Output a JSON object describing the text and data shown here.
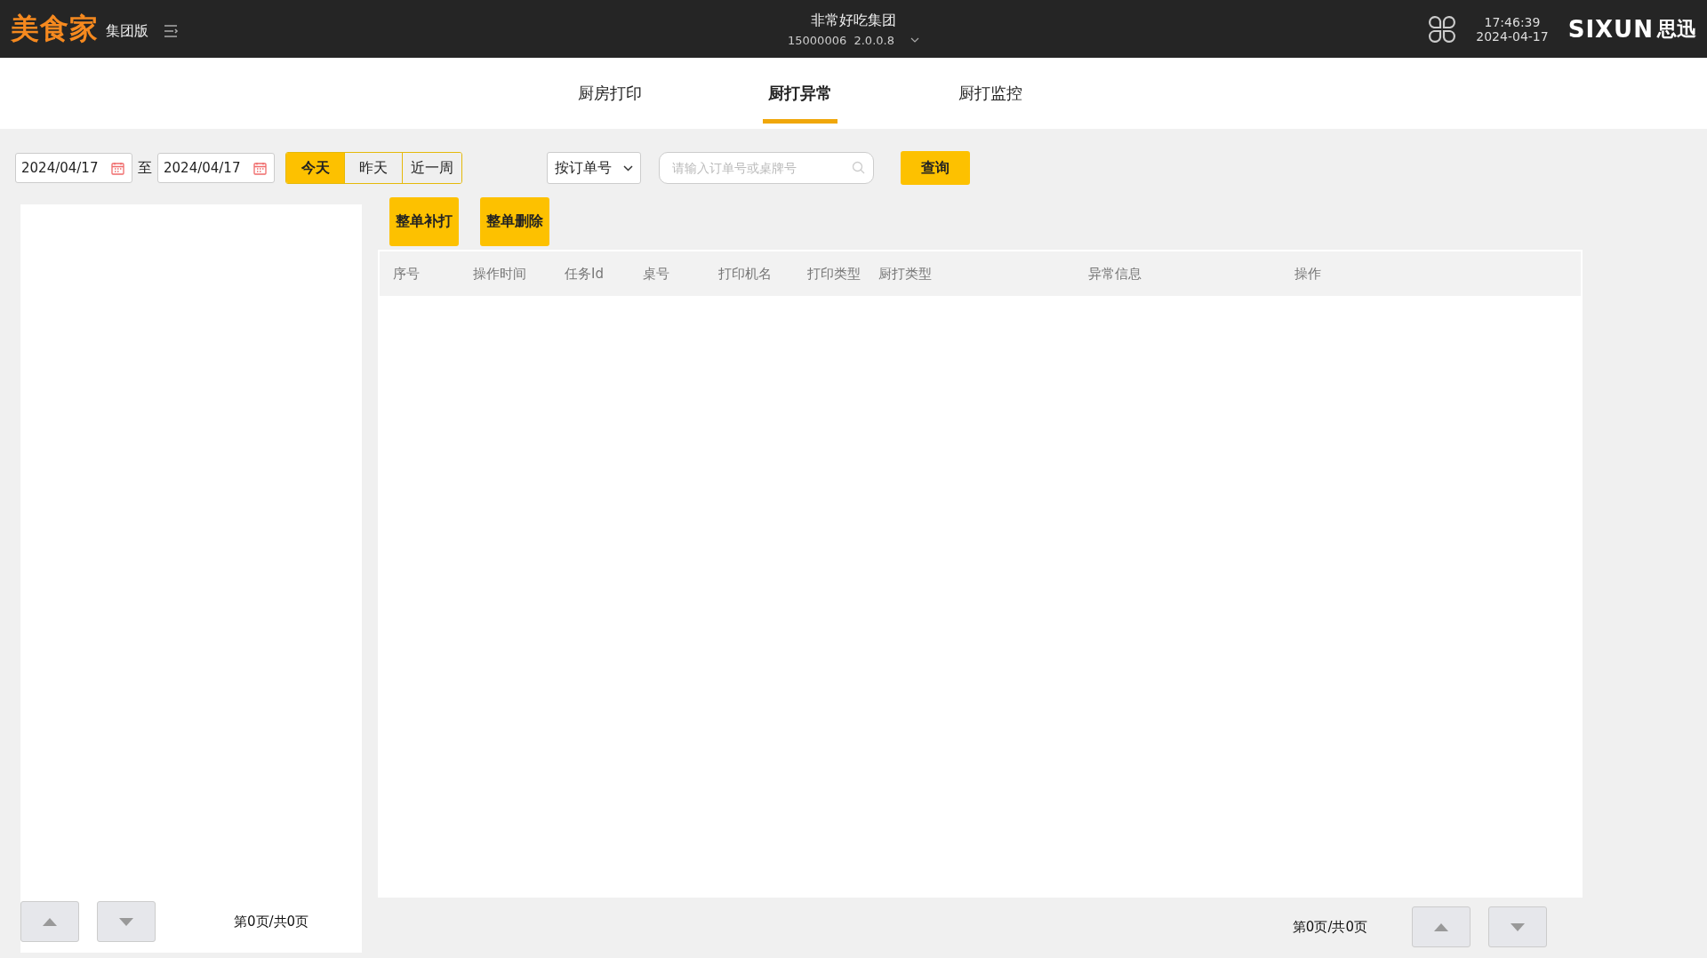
{
  "header": {
    "logo": "美食家",
    "edition": "集团版",
    "group_name": "非常好吃集团",
    "store_info": "15000006  2.0.0.8",
    "time": "17:46:39",
    "date": "2024-04-17",
    "brand": "SIXUN",
    "brand_cn": "思迅"
  },
  "tabs": [
    {
      "label": "厨房打印",
      "selected": false
    },
    {
      "label": "厨打异常",
      "selected": true
    },
    {
      "label": "厨打监控",
      "selected": false
    }
  ],
  "filters": {
    "start_date": "2024/04/17",
    "separator": "至",
    "end_date": "2024/04/17",
    "ranges": [
      {
        "label": "今天",
        "selected": true
      },
      {
        "label": "昨天",
        "selected": false
      },
      {
        "label": "近一周",
        "selected": false
      }
    ],
    "search_by": "按订单号",
    "search_placeholder": "请输入订单号或桌牌号",
    "query_button": "查询"
  },
  "actions": [
    "整单补打",
    "整单删除"
  ],
  "table": {
    "columns": [
      "序号",
      "操作时间",
      "任务Id",
      "桌号",
      "打印机名",
      "打印类型",
      "厨打类型",
      "异常信息",
      "操作"
    ]
  },
  "left_pager": {
    "text": "第0页/共0页"
  },
  "right_pager": {
    "text": "第0页/共0页"
  }
}
